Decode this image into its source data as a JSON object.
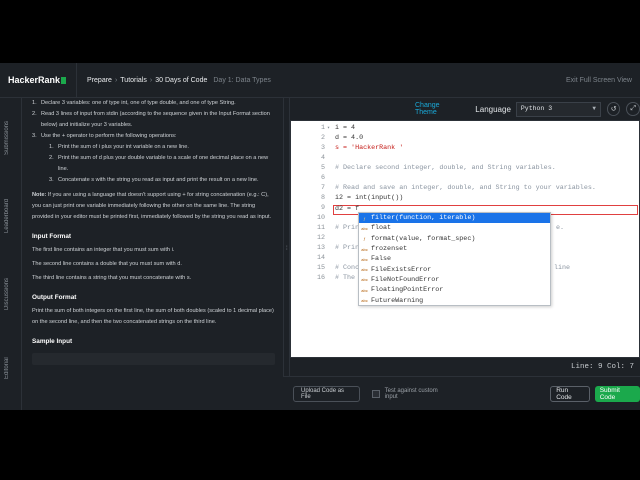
{
  "header": {
    "logo": "HackerRank",
    "breadcrumbs": [
      "Prepare",
      "Tutorials",
      "30 Days of Code"
    ],
    "current_page": "Day 1: Data Types",
    "exit_fullscreen": "Exit Full Screen View"
  },
  "sidebar": {
    "tabs": [
      "Submissions",
      "Leaderboard",
      "Discussions",
      "Editorial"
    ]
  },
  "problem": {
    "steps": [
      {
        "num": "1.",
        "text": "Declare 3 variables: one of type int, one of type double, and one of type String."
      },
      {
        "num": "2.",
        "text": "Read 3 lines of input from stdin (according to the sequence given in the Input Format section below) and initialize your 3 variables."
      },
      {
        "num": "3.",
        "text": "Use the + operator to perform the following operations:"
      }
    ],
    "substeps": [
      {
        "num": "1.",
        "text": "Print the sum of i plus your int variable on a new line."
      },
      {
        "num": "2.",
        "text": "Print the sum of d plus your double variable to a scale of one decimal place on a new line."
      },
      {
        "num": "3.",
        "text": "Concatenate s with the string you read as input and print the result on a new line."
      }
    ],
    "note_label": "Note:",
    "note_text": "If you are using a language that doesn't support using + for string concatenation (e.g.: C), you can just print one variable immediately following the other on the same line. The string provided in your editor must be printed first, immediately followed by the string you read as input.",
    "input_format_title": "Input Format",
    "input_format_lines": [
      "The first line contains an integer that you must sum with i.",
      "The second line contains a double that you must sum with d.",
      "The third line contains a string that you must concatenate with s."
    ],
    "output_format_title": "Output Format",
    "output_format_text": "Print the sum of both integers on the first line, the sum of both doubles (scaled to 1 decimal place) on the second line, and then the two concatenated strings on the third line.",
    "sample_input_title": "Sample Input"
  },
  "editor": {
    "change_theme": "Change Theme",
    "language_label": "Language",
    "language_value": "Python 3",
    "reset_icon": "history-icon",
    "fullscreen_icon": "expand-icon",
    "lines": [
      {
        "n": "1",
        "text": "i = 4"
      },
      {
        "n": "2",
        "text": "d = 4.0"
      },
      {
        "n": "3",
        "text": "s = 'HackerRank '"
      },
      {
        "n": "5",
        "text": "# Declare second integer, double, and String variables."
      },
      {
        "n": "7",
        "text": "# Read and save an integer, double, and String to your variables."
      },
      {
        "n": "8",
        "text": "i2 = int(input())"
      },
      {
        "n": "9",
        "text": "d2 = f"
      },
      {
        "n": "11",
        "text": "# Prin"
      },
      {
        "n": "13",
        "text": "# Prin"
      },
      {
        "n": "15",
        "text": "# Conc"
      },
      {
        "n": "16",
        "text": "# The "
      }
    ],
    "line_tails": {
      "l11": "e.",
      "l15": "line"
    },
    "autocomplete": [
      {
        "icon": "fn",
        "label": "filter(function, iterable)"
      },
      {
        "icon": "kw",
        "label": "float"
      },
      {
        "icon": "fn",
        "label": "format(value, format_spec)"
      },
      {
        "icon": "kw",
        "label": "frozenset"
      },
      {
        "icon": "kw",
        "label": "False"
      },
      {
        "icon": "kw",
        "label": "FileExistsError"
      },
      {
        "icon": "kw",
        "label": "FileNotFoundError"
      },
      {
        "icon": "kw",
        "label": "FloatingPointError"
      },
      {
        "icon": "kw",
        "label": "FutureWarning"
      }
    ],
    "status": "Line: 9 Col: 7"
  },
  "footer": {
    "upload": "Upload Code as File",
    "custom_input": "Test against custom input",
    "run": "Run Code",
    "submit": "Submit Code"
  },
  "colors": {
    "accent_green": "#1ba94c",
    "link_blue": "#1aa9d8",
    "selection_blue": "#1a73e8"
  }
}
